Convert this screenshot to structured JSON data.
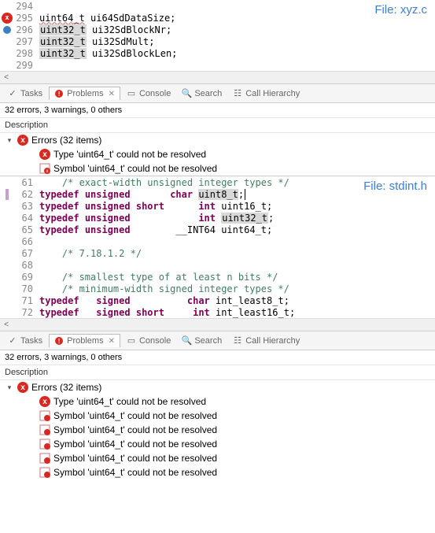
{
  "editor1": {
    "file_label": "File: xyz.c",
    "lines": [
      {
        "num": "294",
        "content": ""
      },
      {
        "num": "295",
        "content": "uint64_t ui64SdDataSize;"
      },
      {
        "num": "296",
        "content": "uint32_t ui32SdBlockNr;"
      },
      {
        "num": "297",
        "content": "uint32_t ui32SdMult;"
      },
      {
        "num": "298",
        "content": "uint32_t ui32SdBlockLen;"
      },
      {
        "num": "299",
        "content": ""
      }
    ]
  },
  "tabs": {
    "tasks": "Tasks",
    "problems": "Problems",
    "console": "Console",
    "search": "Search",
    "callhierarchy": "Call Hierarchy"
  },
  "status": "32 errors, 3 warnings, 0 others",
  "description_header": "Description",
  "tree1": {
    "errors_label": "Errors (32 items)",
    "items": [
      {
        "type": "err",
        "text": "Type 'uint64_t' could not be resolved"
      },
      {
        "type": "warn",
        "text": "Symbol 'uint64_t' could not be resolved"
      }
    ]
  },
  "editor2": {
    "file_label": "File: stdint.h",
    "lines": [
      {
        "num": "61",
        "content": "    /* exact-width unsigned integer types */"
      },
      {
        "num": "62",
        "content": "typedef unsigned       char uint8_t;"
      },
      {
        "num": "63",
        "content": "typedef unsigned short      int uint16_t;"
      },
      {
        "num": "64",
        "content": "typedef unsigned            int uint32_t;"
      },
      {
        "num": "65",
        "content": "typedef unsigned        __INT64 uint64_t;"
      },
      {
        "num": "66",
        "content": ""
      },
      {
        "num": "67",
        "content": "    /* 7.18.1.2 */"
      },
      {
        "num": "68",
        "content": ""
      },
      {
        "num": "69",
        "content": "    /* smallest type of at least n bits */"
      },
      {
        "num": "70",
        "content": "    /* minimum-width signed integer types */"
      },
      {
        "num": "71",
        "content": "typedef   signed          char int_least8_t;"
      },
      {
        "num": "72",
        "content": "typedef   signed short     int int_least16_t;"
      }
    ]
  },
  "tree2": {
    "errors_label": "Errors (32 items)",
    "items": [
      {
        "type": "err",
        "text": "Type 'uint64_t' could not be resolved"
      },
      {
        "type": "warn",
        "text": "Symbol 'uint64_t' could not be resolved"
      },
      {
        "type": "warn",
        "text": "Symbol 'uint64_t' could not be resolved"
      },
      {
        "type": "warn",
        "text": "Symbol 'uint64_t' could not be resolved"
      },
      {
        "type": "warn",
        "text": "Symbol 'uint64_t' could not be resolved"
      },
      {
        "type": "warn",
        "text": "Symbol 'uint64_t' could not be resolved"
      }
    ]
  }
}
